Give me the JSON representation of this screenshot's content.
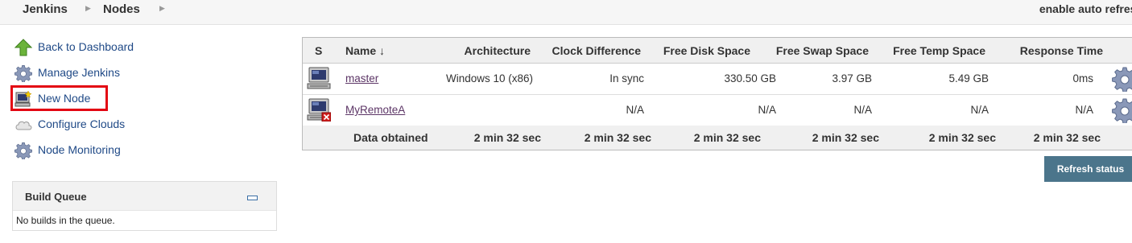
{
  "breadcrumb": {
    "items": [
      "Jenkins",
      "Nodes"
    ]
  },
  "header": {
    "auto_refresh": "enable auto refresh"
  },
  "sidebar": {
    "tasks": [
      {
        "label": "Back to Dashboard",
        "icon": "up-arrow-icon"
      },
      {
        "label": "Manage Jenkins",
        "icon": "gear-icon"
      },
      {
        "label": "New Node",
        "icon": "computer-new-icon"
      },
      {
        "label": "Configure Clouds",
        "icon": "cloud-icon"
      },
      {
        "label": "Node Monitoring",
        "icon": "gear-icon"
      }
    ],
    "highlight_color": "#e30613"
  },
  "build_queue": {
    "title": "Build Queue",
    "empty_text": "No builds in the queue."
  },
  "table": {
    "headers": [
      "S",
      "Name ↓",
      "Architecture",
      "Clock Difference",
      "Free Disk Space",
      "Free Swap Space",
      "Free Temp Space",
      "Response Time"
    ],
    "rows": [
      {
        "status": "online",
        "name": "master",
        "architecture": "Windows 10 (x86)",
        "clock": "In sync",
        "disk": "330.50 GB",
        "swap": "3.97 GB",
        "temp": "5.49 GB",
        "response": "0ms"
      },
      {
        "status": "offline",
        "name": "MyRemoteA",
        "architecture": "",
        "clock": "N/A",
        "disk": "N/A",
        "swap": "N/A",
        "temp": "N/A",
        "response": "N/A"
      }
    ],
    "footer": {
      "label": "Data obtained",
      "values": [
        "2 min 32 sec",
        "2 min 32 sec",
        "2 min 32 sec",
        "2 min 32 sec",
        "2 min 32 sec",
        "2 min 32 sec"
      ]
    }
  },
  "refresh_button": {
    "label": "Refresh status",
    "color": "#4b758b"
  }
}
